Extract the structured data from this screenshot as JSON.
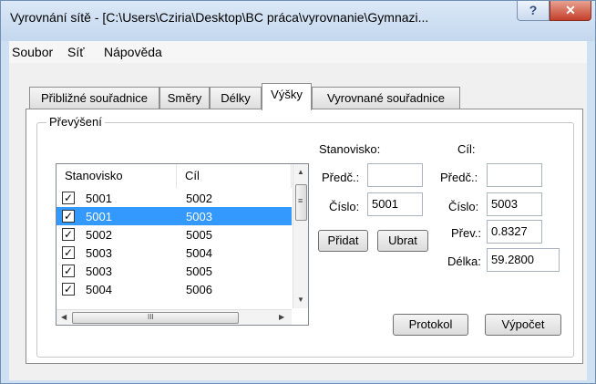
{
  "window": {
    "title": "Vyrovnání sítě - [C:\\Users\\Cziria\\Desktop\\BC práca\\vyrovnanie\\Gymnazi...",
    "help_glyph": "?",
    "close_glyph": "✕"
  },
  "menu": [
    "Soubor",
    "Síť",
    "Nápověda"
  ],
  "tabs": [
    "Přibližné souřadnice",
    "Směry",
    "Délky",
    "Výšky",
    "Vyrovnané souřadnice"
  ],
  "active_tab": "Výšky",
  "group": {
    "title": "Převýšení"
  },
  "list": {
    "columns": [
      "Stanovisko",
      "Cíl"
    ],
    "rows": [
      {
        "checked": true,
        "stanovisko": "5001",
        "cil": "5002",
        "selected": false
      },
      {
        "checked": true,
        "stanovisko": "5001",
        "cil": "5003",
        "selected": true
      },
      {
        "checked": true,
        "stanovisko": "5002",
        "cil": "5005",
        "selected": false
      },
      {
        "checked": true,
        "stanovisko": "5003",
        "cil": "5004",
        "selected": false
      },
      {
        "checked": true,
        "stanovisko": "5003",
        "cil": "5005",
        "selected": false
      },
      {
        "checked": true,
        "stanovisko": "5004",
        "cil": "5006",
        "selected": false
      }
    ],
    "check_glyph": "✓"
  },
  "scroll": {
    "up": "▲",
    "down": "▼",
    "left": "◀",
    "right": "▶",
    "grip_v": "≡",
    "grip_h": "III"
  },
  "stanovisko": {
    "header": "Stanovisko:",
    "predc_label": "Předč.:",
    "predc_value": "",
    "cislo_label": "Číslo:",
    "cislo_value": "5001"
  },
  "cil": {
    "header": "Cíl:",
    "predc_label": "Předč.:",
    "predc_value": "",
    "cislo_label": "Číslo:",
    "cislo_value": "5003",
    "prev_label": "Přev.:",
    "prev_value": "0.8327",
    "delka_label": "Délka:",
    "delka_value": "59.2800"
  },
  "buttons": {
    "pridat": "Přidat",
    "ubrat": "Ubrat",
    "protokol": "Protokol",
    "vypocet": "Výpočet"
  }
}
